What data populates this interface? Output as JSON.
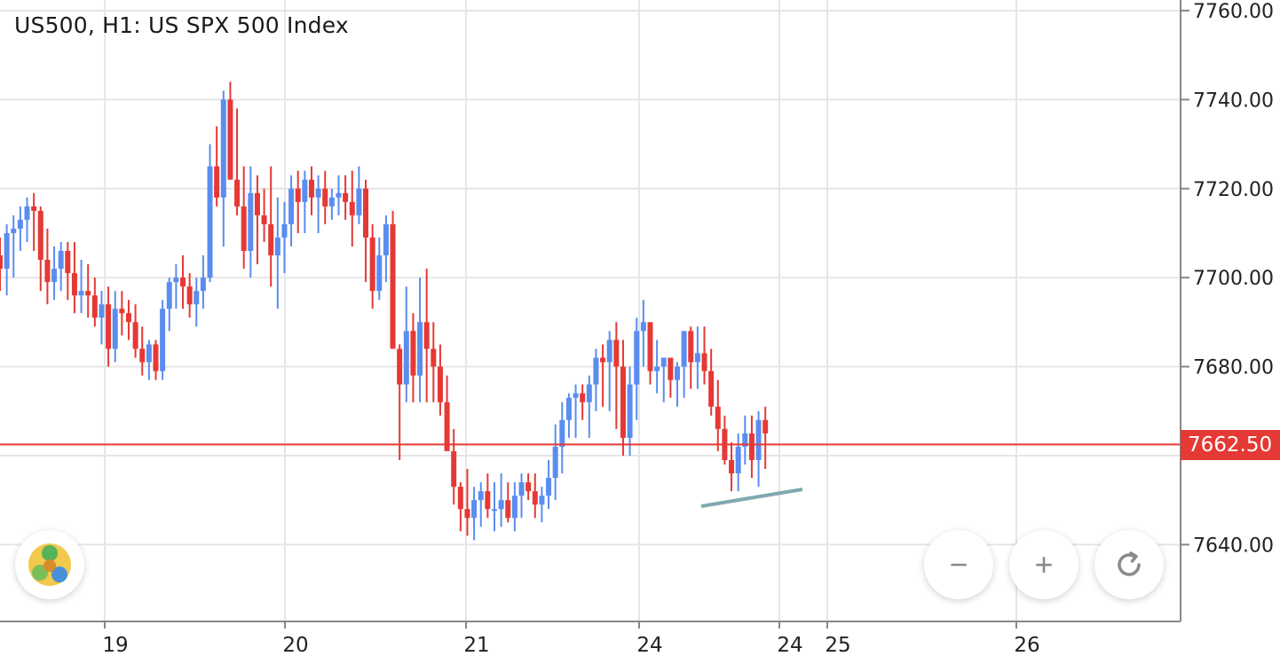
{
  "header": {
    "title": "US500, H1: US SPX 500 Index"
  },
  "current_price": {
    "label": "7662.50",
    "value": 7662.5,
    "color": "#e53935"
  },
  "controls": {
    "zoom_out_label": "−",
    "zoom_in_label": "+",
    "reset_icon": "rotate-icon",
    "logo_icon": "metatrader-logo-icon"
  },
  "colors": {
    "bull": "#5b8def",
    "bear": "#e53935",
    "grid": "#e6e6e6",
    "trendline": "#7fa9b0"
  },
  "chart_data": {
    "type": "candlestick",
    "title": "US500, H1: US SPX 500 Index",
    "ylim": [
      7620,
      7760
    ],
    "y_ticks": [
      "7640.00",
      "7680.00",
      "7700.00",
      "7720.00",
      "7740.00",
      "7760.00"
    ],
    "y_tick_values": [
      7640,
      7680,
      7700,
      7720,
      7740,
      7760
    ],
    "x_ticks": [
      {
        "label": "19",
        "index": 12
      },
      {
        "label": "20",
        "index": 52
      },
      {
        "label": "21",
        "index": 93
      },
      {
        "label": "24",
        "index": 133
      },
      {
        "label": "24",
        "index": 164
      },
      {
        "label": "25",
        "index": 175
      },
      {
        "label": "26",
        "index": 217
      }
    ],
    "grid": true,
    "ohlc": [
      [
        7705,
        7709,
        7697,
        7702
      ],
      [
        7702,
        7712,
        7696,
        7710
      ],
      [
        7710,
        7714,
        7700,
        7711
      ],
      [
        7711,
        7716,
        7706,
        7713
      ],
      [
        7713,
        7718,
        7708,
        7716
      ],
      [
        7716,
        7719,
        7706,
        7715
      ],
      [
        7715,
        7716,
        7697,
        7704
      ],
      [
        7704,
        7711,
        7694,
        7699
      ],
      [
        7699,
        7707,
        7695,
        7702
      ],
      [
        7702,
        7708,
        7697,
        7706
      ],
      [
        7706,
        7708,
        7695,
        7701
      ],
      [
        7701,
        7708,
        7692,
        7696
      ],
      [
        7696,
        7704,
        7692,
        7697
      ],
      [
        7697,
        7703,
        7691,
        7696
      ],
      [
        7696,
        7700,
        7689,
        7691
      ],
      [
        7691,
        7697,
        7685,
        7694
      ],
      [
        7694,
        7698,
        7680,
        7684
      ],
      [
        7684,
        7697,
        7681,
        7693
      ],
      [
        7693,
        7697,
        7687,
        7692
      ],
      [
        7692,
        7695,
        7686,
        7690
      ],
      [
        7690,
        7694,
        7682,
        7684
      ],
      [
        7684,
        7689,
        7678,
        7681
      ],
      [
        7681,
        7686,
        7677,
        7685
      ],
      [
        7685,
        7686,
        7677,
        7679
      ],
      [
        7679,
        7695,
        7677,
        7693
      ],
      [
        7693,
        7700,
        7688,
        7699
      ],
      [
        7699,
        7703,
        7693,
        7700
      ],
      [
        7700,
        7705,
        7693,
        7698
      ],
      [
        7698,
        7701,
        7691,
        7694
      ],
      [
        7694,
        7700,
        7689,
        7697
      ],
      [
        7697,
        7705,
        7693,
        7700
      ],
      [
        7700,
        7730,
        7699,
        7725
      ],
      [
        7725,
        7734,
        7716,
        7718
      ],
      [
        7718,
        7742,
        7707,
        7740
      ],
      [
        7740,
        7744,
        7725,
        7722
      ],
      [
        7722,
        7738,
        7714,
        7716
      ],
      [
        7716,
        7725,
        7702,
        7706
      ],
      [
        7706,
        7725,
        7700,
        7719
      ],
      [
        7719,
        7723,
        7703,
        7714
      ],
      [
        7714,
        7720,
        7708,
        7712
      ],
      [
        7712,
        7725,
        7698,
        7705
      ],
      [
        7705,
        7718,
        7693,
        7709
      ],
      [
        7709,
        7717,
        7701,
        7712
      ],
      [
        7712,
        7723,
        7707,
        7720
      ],
      [
        7720,
        7724,
        7710,
        7717
      ],
      [
        7717,
        7724,
        7710,
        7722
      ],
      [
        7722,
        7725,
        7714,
        7718
      ],
      [
        7718,
        7723,
        7710,
        7720
      ],
      [
        7720,
        7724,
        7712,
        7716
      ],
      [
        7716,
        7720,
        7713,
        7718
      ],
      [
        7718,
        7723,
        7714,
        7719
      ],
      [
        7719,
        7723,
        7713,
        7717
      ],
      [
        7717,
        7724,
        7707,
        7714
      ],
      [
        7714,
        7725,
        7712,
        7720
      ],
      [
        7720,
        7722,
        7699,
        7709
      ],
      [
        7709,
        7712,
        7693,
        7697
      ],
      [
        7697,
        7709,
        7695,
        7705
      ],
      [
        7705,
        7714,
        7699,
        7712
      ],
      [
        7712,
        7715,
        7684,
        7684
      ],
      [
        7684,
        7685,
        7659,
        7676
      ],
      [
        7676,
        7698,
        7672,
        7688
      ],
      [
        7688,
        7692,
        7672,
        7678
      ],
      [
        7678,
        7700,
        7672,
        7690
      ],
      [
        7690,
        7702,
        7672,
        7684
      ],
      [
        7684,
        7690,
        7672,
        7680
      ],
      [
        7680,
        7685,
        7669,
        7672
      ],
      [
        7672,
        7678,
        7664,
        7661
      ],
      [
        7661,
        7666,
        7649,
        7653
      ],
      [
        7653,
        7654,
        7643,
        7648
      ],
      [
        7648,
        7657,
        7642,
        7646
      ],
      [
        7646,
        7653,
        7641,
        7650
      ],
      [
        7650,
        7654,
        7644,
        7652
      ],
      [
        7652,
        7656,
        7646,
        7648
      ],
      [
        7648,
        7654,
        7643,
        7648
      ],
      [
        7648,
        7656,
        7644,
        7650
      ],
      [
        7650,
        7654,
        7645,
        7646
      ],
      [
        7646,
        7654,
        7643,
        7651
      ],
      [
        7651,
        7656,
        7646,
        7654
      ],
      [
        7654,
        7656,
        7650,
        7652
      ],
      [
        7652,
        7656,
        7646,
        7649
      ],
      [
        7649,
        7653,
        7645,
        7651
      ],
      [
        7651,
        7659,
        7648,
        7655
      ],
      [
        7655,
        7667,
        7650,
        7662
      ],
      [
        7662,
        7672,
        7656,
        7668
      ],
      [
        7668,
        7674,
        7664,
        7673
      ],
      [
        7673,
        7676,
        7664,
        7674
      ],
      [
        7674,
        7676,
        7668,
        7672
      ],
      [
        7672,
        7678,
        7664,
        7676
      ],
      [
        7676,
        7684,
        7670,
        7682
      ],
      [
        7682,
        7685,
        7671,
        7681
      ],
      [
        7681,
        7688,
        7670,
        7686
      ],
      [
        7686,
        7690,
        7666,
        7680
      ],
      [
        7680,
        7686,
        7660,
        7664
      ],
      [
        7664,
        7680,
        7660,
        7676
      ],
      [
        7676,
        7691,
        7668,
        7688
      ],
      [
        7688,
        7695,
        7680,
        7690
      ],
      [
        7690,
        7689,
        7676,
        7679
      ],
      [
        7679,
        7686,
        7674,
        7680
      ],
      [
        7680,
        7682,
        7672,
        7682
      ],
      [
        7682,
        7682,
        7673,
        7677
      ],
      [
        7677,
        7681,
        7671,
        7680
      ],
      [
        7680,
        7688,
        7673,
        7688
      ],
      [
        7688,
        7689,
        7675,
        7681
      ],
      [
        7681,
        7689,
        7675,
        7683
      ],
      [
        7683,
        7689,
        7676,
        7679
      ],
      [
        7679,
        7684,
        7669,
        7671
      ],
      [
        7671,
        7677,
        7661,
        7666
      ],
      [
        7666,
        7669,
        7658,
        7659
      ],
      [
        7659,
        7663,
        7652,
        7656
      ],
      [
        7656,
        7665,
        7652,
        7662
      ],
      [
        7662,
        7669,
        7658,
        7665
      ],
      [
        7665,
        7669,
        7655,
        7659
      ],
      [
        7659,
        7670,
        7653,
        7668
      ],
      [
        7668,
        7671,
        7657,
        7665
      ]
    ],
    "trendline": {
      "from": [
        180,
        7651
      ],
      "to": [
        210,
        7655
      ]
    }
  }
}
